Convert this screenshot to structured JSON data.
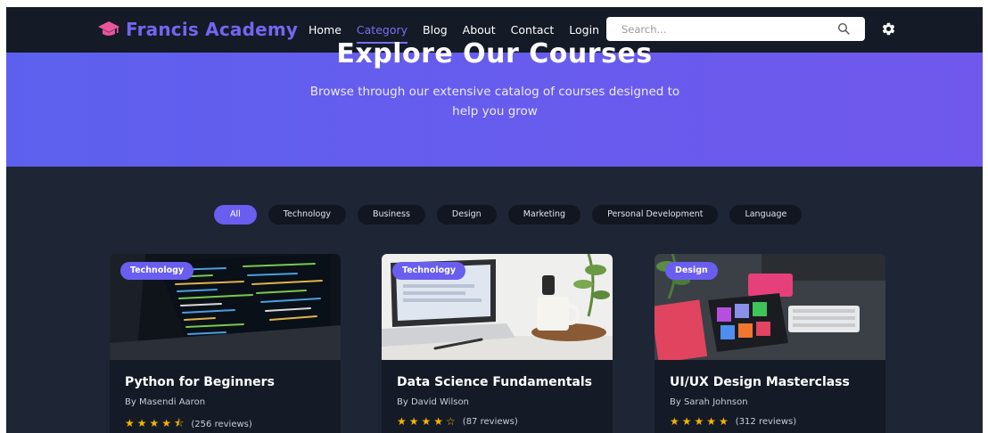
{
  "brand": {
    "name": "Francis Academy",
    "accent": "#7366f0",
    "icon": "graduation-cap-icon"
  },
  "nav": {
    "items": [
      {
        "label": "Home",
        "active": false
      },
      {
        "label": "Category",
        "active": true
      },
      {
        "label": "Blog",
        "active": false
      },
      {
        "label": "About",
        "active": false
      },
      {
        "label": "Contact",
        "active": false
      },
      {
        "label": "Login",
        "active": false
      }
    ]
  },
  "search": {
    "placeholder": "Search...",
    "value": "",
    "icon": "search-icon"
  },
  "settings": {
    "icon": "gear-icon"
  },
  "hero": {
    "title": "Explore Our Courses",
    "subtitle": "Browse through our extensive catalog of courses designed to help you grow"
  },
  "filters": [
    {
      "label": "All",
      "active": true
    },
    {
      "label": "Technology",
      "active": false
    },
    {
      "label": "Business",
      "active": false
    },
    {
      "label": "Design",
      "active": false
    },
    {
      "label": "Marketing",
      "active": false
    },
    {
      "label": "Personal Development",
      "active": false
    },
    {
      "label": "Language",
      "active": false
    }
  ],
  "courses": [
    {
      "category": "Technology",
      "title": "Python for Beginners",
      "author": "By Masendi Aaron",
      "stars": "★★★★⯪",
      "rating": 4.5,
      "reviews": "(256 reviews)"
    },
    {
      "category": "Technology",
      "title": "Data Science Fundamentals",
      "author": "By David Wilson",
      "stars": "★★★★☆",
      "rating": 4,
      "reviews": "(87 reviews)"
    },
    {
      "category": "Design",
      "title": "UI/UX Design Masterclass",
      "author": "By Sarah Johnson",
      "stars": "★★★★★",
      "rating": 5,
      "reviews": "(312 reviews)"
    }
  ],
  "colors": {
    "primary": "#6a5ef0",
    "navbar": "#141a26",
    "page": "#1e2535",
    "star": "#f4b400"
  }
}
